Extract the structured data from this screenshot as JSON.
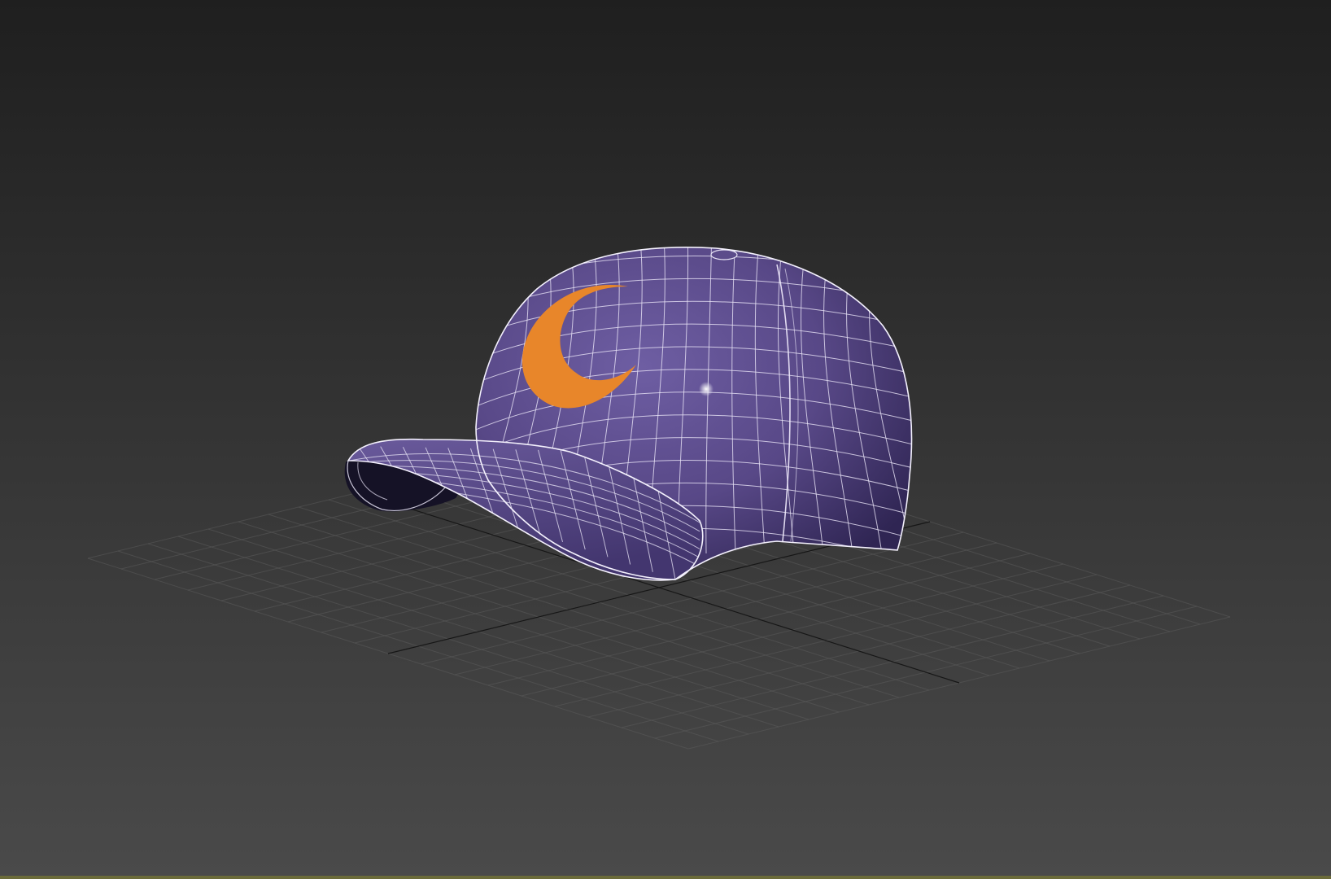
{
  "viewport": {
    "background_top": "#1f1f1f",
    "background_bottom": "#4a4a4a",
    "grid_color": "#5b5b5b",
    "axis_color": "#111111",
    "bottom_edge_color": "#6b6b3a"
  },
  "model": {
    "object": "baseball-cap",
    "shell_color": "#5a4a88",
    "shell_shadow_color": "#2e2452",
    "wireframe_color": "#e8e4f6",
    "logo": {
      "shape": "crescent-moon",
      "color": "#e8862a"
    }
  }
}
